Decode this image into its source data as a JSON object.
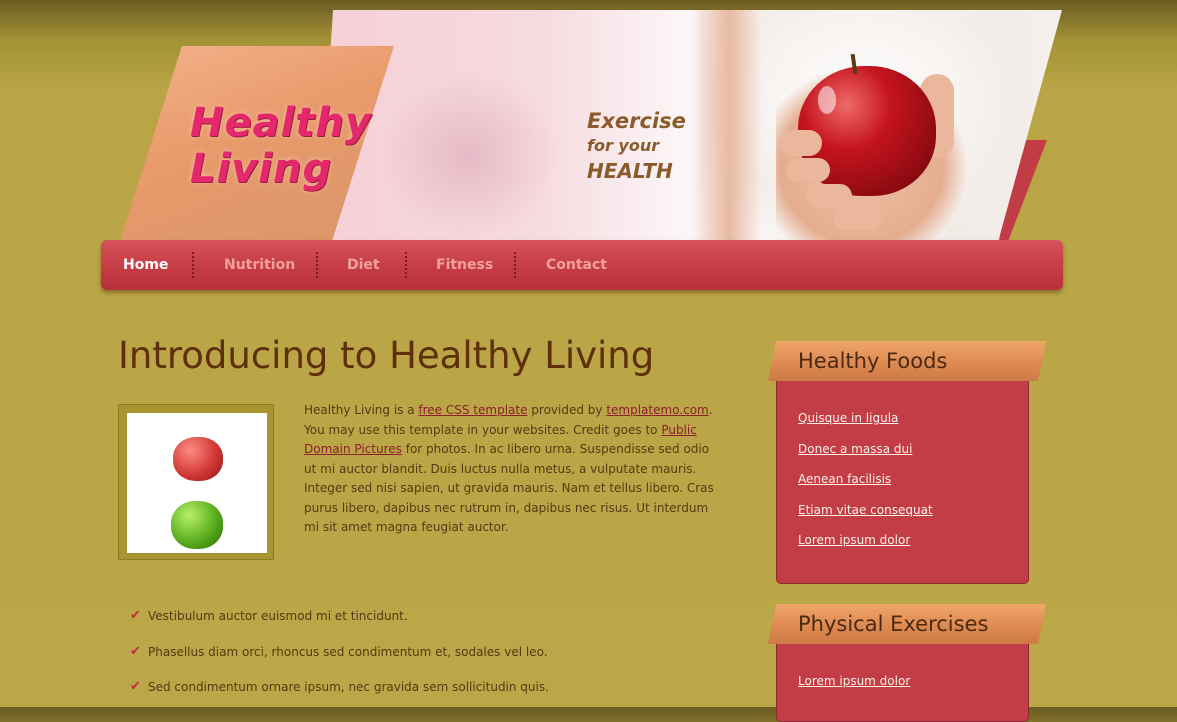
{
  "header": {
    "logo_line1": "Healthy",
    "logo_line2": "Living",
    "slogan_line1": "Exercise",
    "slogan_line2": "for your",
    "slogan_line3": "HEALTH"
  },
  "nav": {
    "items": [
      "Home",
      "Nutrition",
      "Diet",
      "Fitness",
      "Contact"
    ],
    "active": "Home"
  },
  "main": {
    "title": "Introducing to Healthy Living",
    "paragraph": {
      "t1": "Healthy Living is a ",
      "link1": "free CSS template",
      "t2": " provided by ",
      "link2": "templatemo.com",
      "t3": ". You may use this template in your websites. Credit goes to ",
      "link3": "Public Domain Pictures",
      "t4": " for photos. In ac libero urna. Suspendisse sed odio ut mi auctor blandit. Duis luctus nulla metus, a vulputate mauris. Integer sed nisi sapien, ut gravida mauris. Nam et tellus libero. Cras purus libero, dapibus nec rutrum in, dapibus nec risus. Ut interdum mi sit amet magna feugiat auctor."
    },
    "checklist": [
      "Vestibulum auctor euismod mi et tincidunt.",
      "Phasellus diam orci, rhoncus sed condimentum et, sodales vel leo.",
      "Sed condimentum ornare ipsum, nec gravida sem sollicitudin quis."
    ],
    "check_icon": "✔"
  },
  "sidebar": {
    "box1": {
      "title": "Healthy Foods",
      "links": [
        "Quisque in ligula",
        "Donec a massa dui",
        "Aenean facilisis",
        "Etiam vitae consequat",
        "Lorem ipsum dolor"
      ]
    },
    "box2": {
      "title": "Physical Exercises",
      "links": [
        "Lorem ipsum dolor"
      ]
    }
  },
  "colors": {
    "background": "#bba747",
    "nav": "#c53c45",
    "title": "#5f2f0a",
    "box_head": "#dd8a52",
    "box_body": "#c23d45"
  }
}
